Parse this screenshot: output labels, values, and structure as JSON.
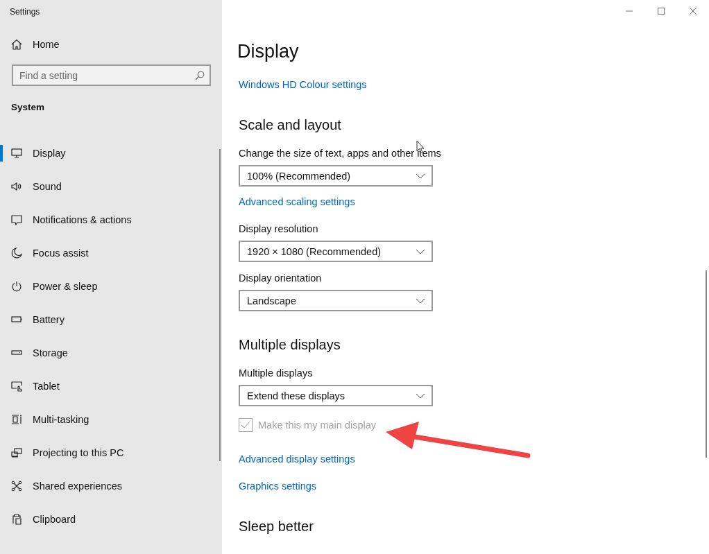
{
  "window": {
    "title": "Settings",
    "controls": [
      {
        "kind": "minimize"
      },
      {
        "kind": "maximize"
      },
      {
        "kind": "close"
      }
    ]
  },
  "sidebar": {
    "home": {
      "label": "Home"
    },
    "search": {
      "placeholder": "Find a setting"
    },
    "section": "System",
    "items": [
      {
        "label": "Display",
        "kind": "display",
        "selected": true
      },
      {
        "label": "Sound",
        "kind": "sound",
        "selected": false
      },
      {
        "label": "Notifications & actions",
        "kind": "notifications",
        "selected": false
      },
      {
        "label": "Focus assist",
        "kind": "moon",
        "selected": false
      },
      {
        "label": "Power & sleep",
        "kind": "power",
        "selected": false
      },
      {
        "label": "Battery",
        "kind": "battery",
        "selected": false
      },
      {
        "label": "Storage",
        "kind": "storage",
        "selected": false
      },
      {
        "label": "Tablet",
        "kind": "tablet",
        "selected": false
      },
      {
        "label": "Multi-tasking",
        "kind": "multitask",
        "selected": false
      },
      {
        "label": "Projecting to this PC",
        "kind": "project",
        "selected": false
      },
      {
        "label": "Shared experiences",
        "kind": "shared",
        "selected": false
      },
      {
        "label": "Clipboard",
        "kind": "clipboard",
        "selected": false
      }
    ]
  },
  "page": {
    "title": "Display",
    "blocks": [
      {
        "kind": "link",
        "text": "Windows HD Colour settings"
      },
      {
        "kind": "heading",
        "text": "Scale and layout"
      },
      {
        "kind": "label",
        "text": "Change the size of text, apps and other items"
      },
      {
        "kind": "dropdown",
        "value": "100% (Recommended)"
      },
      {
        "kind": "link",
        "text": "Advanced scaling settings"
      },
      {
        "kind": "label",
        "text": "Display resolution"
      },
      {
        "kind": "dropdown",
        "value": "1920 × 1080 (Recommended)"
      },
      {
        "kind": "label",
        "text": "Display orientation"
      },
      {
        "kind": "dropdown",
        "value": "Landscape"
      },
      {
        "kind": "heading",
        "text": "Multiple displays"
      },
      {
        "kind": "label",
        "text": "Multiple displays"
      },
      {
        "kind": "dropdown",
        "value": "Extend these displays"
      },
      {
        "kind": "checkbox",
        "text": "Make this my main display",
        "checked": true,
        "disabled": true
      },
      {
        "kind": "link",
        "text": "Advanced display settings"
      },
      {
        "kind": "link",
        "text": "Graphics settings"
      },
      {
        "kind": "heading",
        "text": "Sleep better"
      }
    ]
  },
  "annotations": [
    {
      "kind": "arrow"
    }
  ]
}
